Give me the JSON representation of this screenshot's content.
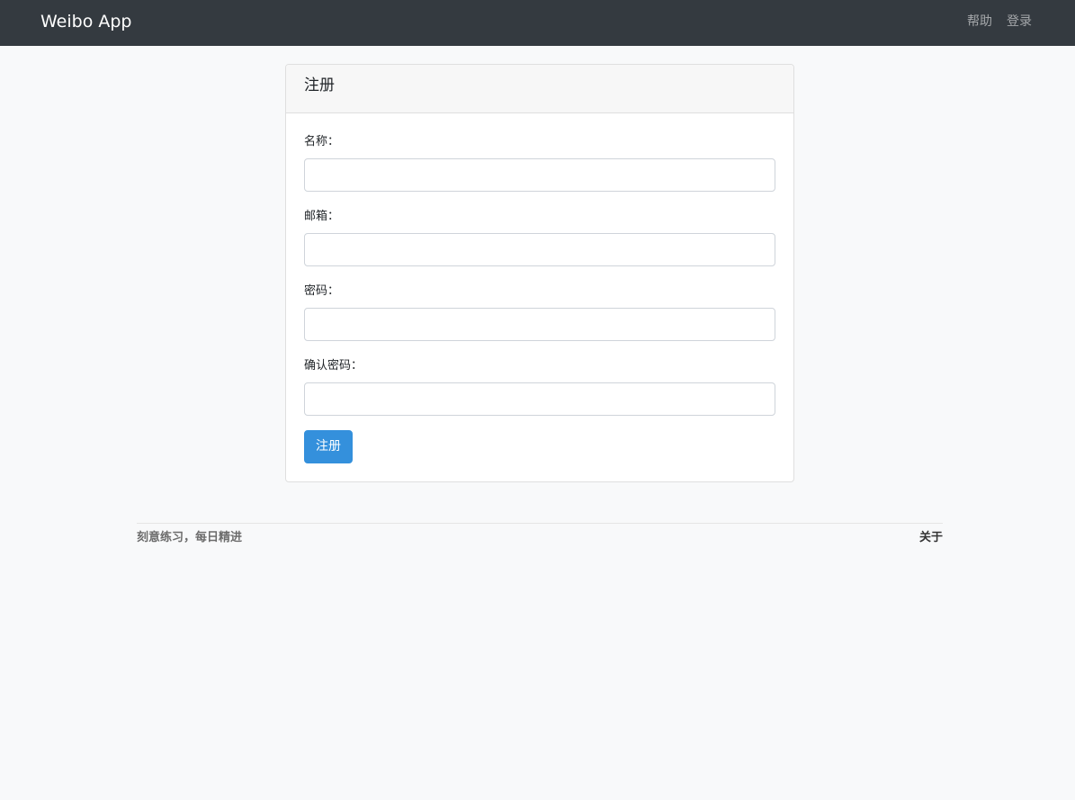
{
  "navbar": {
    "brand": "Weibo App",
    "links": [
      {
        "label": "帮助"
      },
      {
        "label": "登录"
      }
    ]
  },
  "signup_card": {
    "title": "注册",
    "fields": [
      {
        "label": "名称：",
        "value": "",
        "placeholder": ""
      },
      {
        "label": "邮箱：",
        "value": "",
        "placeholder": ""
      },
      {
        "label": "密码：",
        "value": "",
        "placeholder": ""
      },
      {
        "label": "确认密码：",
        "value": "",
        "placeholder": ""
      }
    ],
    "submit_label": "注册"
  },
  "footer": {
    "text": "刻意练习，每日精进",
    "about_label": "关于"
  },
  "colors": {
    "navbar_bg": "#343a40",
    "page_bg": "#f8f9fa",
    "primary_button": "#3490dc"
  }
}
